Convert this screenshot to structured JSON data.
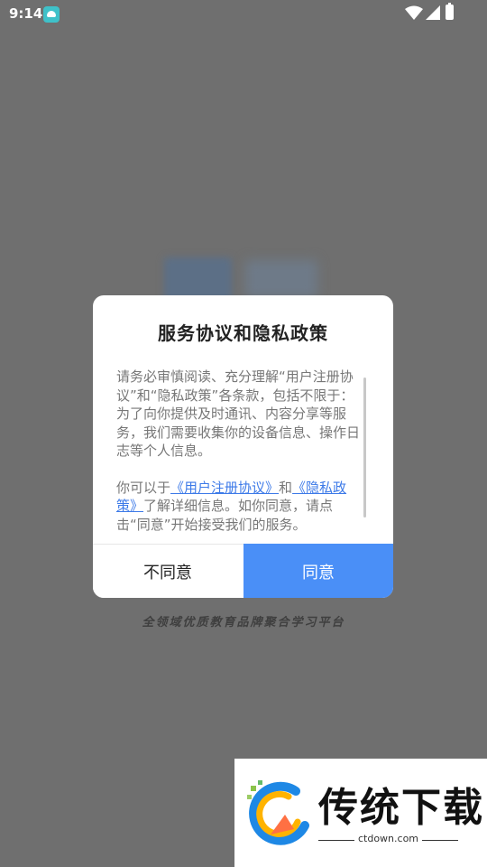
{
  "status_bar": {
    "time": "9:14"
  },
  "dialog": {
    "title": "服务协议和隐私政策",
    "paragraph1": "请务必审慎阅读、充分理解“用户注册协议”和“隐私政策”各条款，包括不限于：为了向你提供及时通讯、内容分享等服务，我们需要收集你的设备信息、操作日志等个人信息。",
    "p2_prefix": "你可以于",
    "link_user_agreement": "《用户注册协议》",
    "p2_and": "和",
    "link_privacy_policy": "《隐私政策》",
    "p2_suffix": "了解详细信息。如你同意，请点击“同意”开始接受我们的服务。",
    "disagree_label": "不同意",
    "agree_label": "同意"
  },
  "slogan": "全领域优质教育品牌聚合学习平台",
  "watermark": {
    "title": "传统下载",
    "url": "ctdown.com"
  },
  "colors": {
    "accent": "#4a8ff7",
    "link": "#3d7ae8",
    "overlay": "#6f6f6f"
  }
}
